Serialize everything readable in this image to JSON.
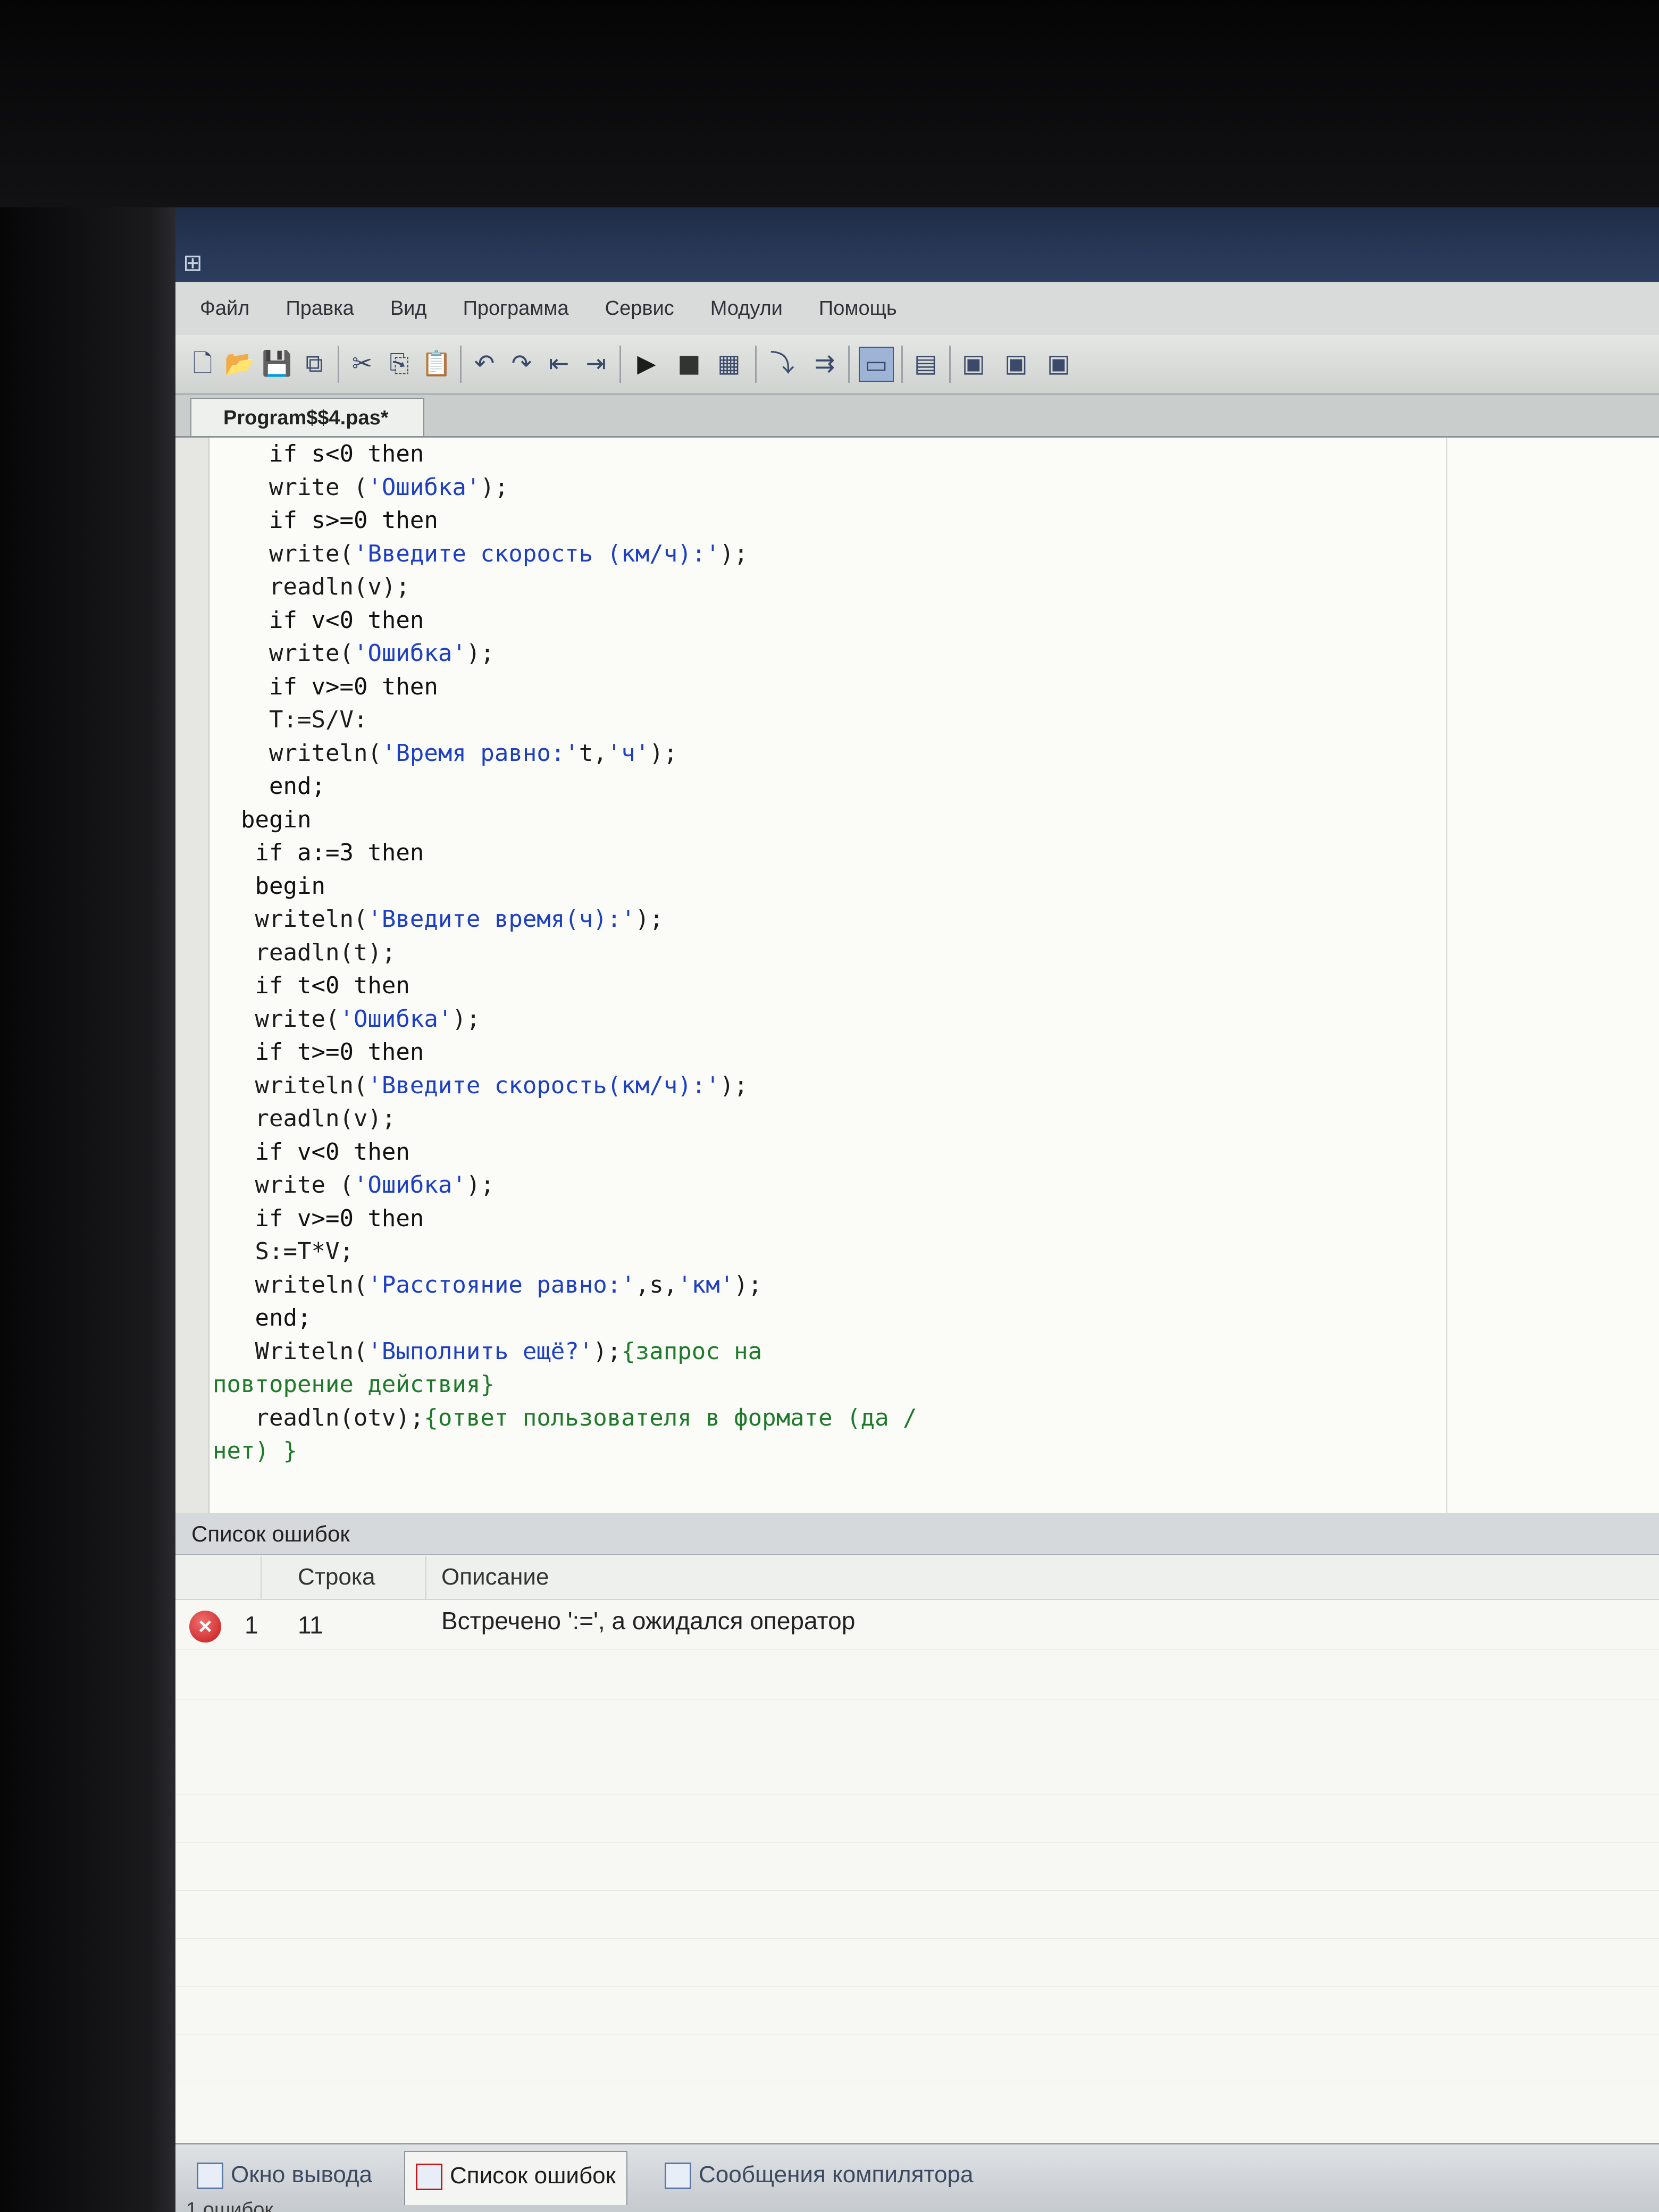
{
  "menu": [
    "Файл",
    "Правка",
    "Вид",
    "Программа",
    "Сервис",
    "Модули",
    "Помощь"
  ],
  "toolbar_icons": [
    "new-file-icon",
    "open-file-icon",
    "save-icon",
    "save-all-icon",
    "cut-icon",
    "copy-icon",
    "paste-icon",
    "undo-icon",
    "redo-icon",
    "back-icon",
    "forward-icon",
    "run-icon",
    "stop-icon",
    "compile-icon",
    "step-into-icon",
    "step-over-icon",
    "console-icon",
    "watch-icon",
    "module-d-icon",
    "module-l-icon",
    "module-r-icon"
  ],
  "editor": {
    "tab_label": "Program$$4.pas*",
    "lines": [
      {
        "indent": 4,
        "parts": [
          {
            "t": "if s<0 then",
            "c": "kw"
          }
        ]
      },
      {
        "indent": 4,
        "parts": [
          {
            "t": "write (",
            "c": ""
          },
          {
            "t": "'Ошибка'",
            "c": "str"
          },
          {
            "t": ");",
            "c": ""
          }
        ]
      },
      {
        "indent": 4,
        "parts": [
          {
            "t": "if s>=0 then",
            "c": "kw"
          }
        ]
      },
      {
        "indent": 4,
        "parts": [
          {
            "t": "write(",
            "c": ""
          },
          {
            "t": "'Введите скорость (км/ч):'",
            "c": "str"
          },
          {
            "t": ");",
            "c": ""
          }
        ]
      },
      {
        "indent": 4,
        "parts": [
          {
            "t": "readln(v);",
            "c": ""
          }
        ]
      },
      {
        "indent": 4,
        "parts": [
          {
            "t": "if v<0 then",
            "c": "kw"
          }
        ]
      },
      {
        "indent": 4,
        "parts": [
          {
            "t": "write(",
            "c": ""
          },
          {
            "t": "'Ошибка'",
            "c": "str"
          },
          {
            "t": ");",
            "c": ""
          }
        ]
      },
      {
        "indent": 4,
        "parts": [
          {
            "t": "if v>=0 then",
            "c": "kw"
          }
        ]
      },
      {
        "indent": 4,
        "parts": [
          {
            "t": "T:=S/V:",
            "c": ""
          }
        ]
      },
      {
        "indent": 4,
        "parts": [
          {
            "t": "writeln(",
            "c": ""
          },
          {
            "t": "'Время равно:'",
            "c": "str"
          },
          {
            "t": "t,",
            "c": ""
          },
          {
            "t": "'ч'",
            "c": "str"
          },
          {
            "t": ");",
            "c": ""
          }
        ]
      },
      {
        "indent": 4,
        "parts": [
          {
            "t": "end;",
            "c": "kw"
          }
        ]
      },
      {
        "indent": 2,
        "parts": [
          {
            "t": "begin",
            "c": "kw"
          }
        ]
      },
      {
        "indent": 3,
        "parts": [
          {
            "t": "if a:=3 then",
            "c": "kw"
          }
        ]
      },
      {
        "indent": 3,
        "parts": [
          {
            "t": "begin",
            "c": "kw"
          }
        ]
      },
      {
        "indent": 3,
        "parts": [
          {
            "t": "writeln(",
            "c": ""
          },
          {
            "t": "'Введите время(ч):'",
            "c": "str"
          },
          {
            "t": ");",
            "c": ""
          }
        ]
      },
      {
        "indent": 3,
        "parts": [
          {
            "t": "readln(t);",
            "c": ""
          }
        ]
      },
      {
        "indent": 3,
        "parts": [
          {
            "t": "if t<0 then",
            "c": "kw"
          }
        ]
      },
      {
        "indent": 3,
        "parts": [
          {
            "t": "write(",
            "c": ""
          },
          {
            "t": "'Ошибка'",
            "c": "str"
          },
          {
            "t": ");",
            "c": ""
          }
        ]
      },
      {
        "indent": 3,
        "parts": [
          {
            "t": "if t>=0 then",
            "c": "kw"
          }
        ]
      },
      {
        "indent": 3,
        "parts": [
          {
            "t": "writeln(",
            "c": ""
          },
          {
            "t": "'Введите скорость(км/ч):'",
            "c": "str"
          },
          {
            "t": ");",
            "c": ""
          }
        ]
      },
      {
        "indent": 3,
        "parts": [
          {
            "t": "readln(v);",
            "c": ""
          }
        ]
      },
      {
        "indent": 3,
        "parts": [
          {
            "t": "if v<0 then",
            "c": "kw"
          }
        ]
      },
      {
        "indent": 3,
        "parts": [
          {
            "t": "write (",
            "c": ""
          },
          {
            "t": "'Ошибка'",
            "c": "str"
          },
          {
            "t": ");",
            "c": ""
          }
        ]
      },
      {
        "indent": 3,
        "parts": [
          {
            "t": "if v>=0 then",
            "c": "kw"
          }
        ]
      },
      {
        "indent": 3,
        "parts": [
          {
            "t": "S:=T*V;",
            "c": ""
          }
        ]
      },
      {
        "indent": 3,
        "parts": [
          {
            "t": "writeln(",
            "c": ""
          },
          {
            "t": "'Расстояние равно:'",
            "c": "str"
          },
          {
            "t": ",s,",
            "c": ""
          },
          {
            "t": "'км'",
            "c": "str"
          },
          {
            "t": ");",
            "c": ""
          }
        ]
      },
      {
        "indent": 3,
        "parts": [
          {
            "t": "end;",
            "c": "kw"
          }
        ]
      },
      {
        "indent": 3,
        "parts": [
          {
            "t": "Writeln(",
            "c": ""
          },
          {
            "t": "'Выполнить ещё?'",
            "c": "str"
          },
          {
            "t": ");",
            "c": ""
          },
          {
            "t": "{запрос на",
            "c": "cmt"
          }
        ]
      },
      {
        "indent": 0,
        "parts": [
          {
            "t": "повторение действия}",
            "c": "cmt"
          }
        ]
      },
      {
        "indent": 3,
        "parts": [
          {
            "t": "readln(otv);",
            "c": ""
          },
          {
            "t": "{ответ пользователя в формате (да /",
            "c": "cmt"
          }
        ]
      },
      {
        "indent": 0,
        "parts": [
          {
            "t": "нет) }",
            "c": "cmt"
          }
        ]
      }
    ]
  },
  "error_panel": {
    "title": "Список ошибок",
    "columns": [
      "Строка",
      "Описание"
    ],
    "rows": [
      {
        "num": "1",
        "line": "11",
        "description": "Встречено ':=', а ожидался оператор"
      }
    ]
  },
  "bottom_tabs": [
    "Окно вывода",
    "Список ошибок",
    "Сообщения компилятора"
  ],
  "status": "1 ошибок",
  "colors": {
    "string": "#1d3fc2",
    "comment": "#1e7a2a",
    "error": "#c61818"
  }
}
